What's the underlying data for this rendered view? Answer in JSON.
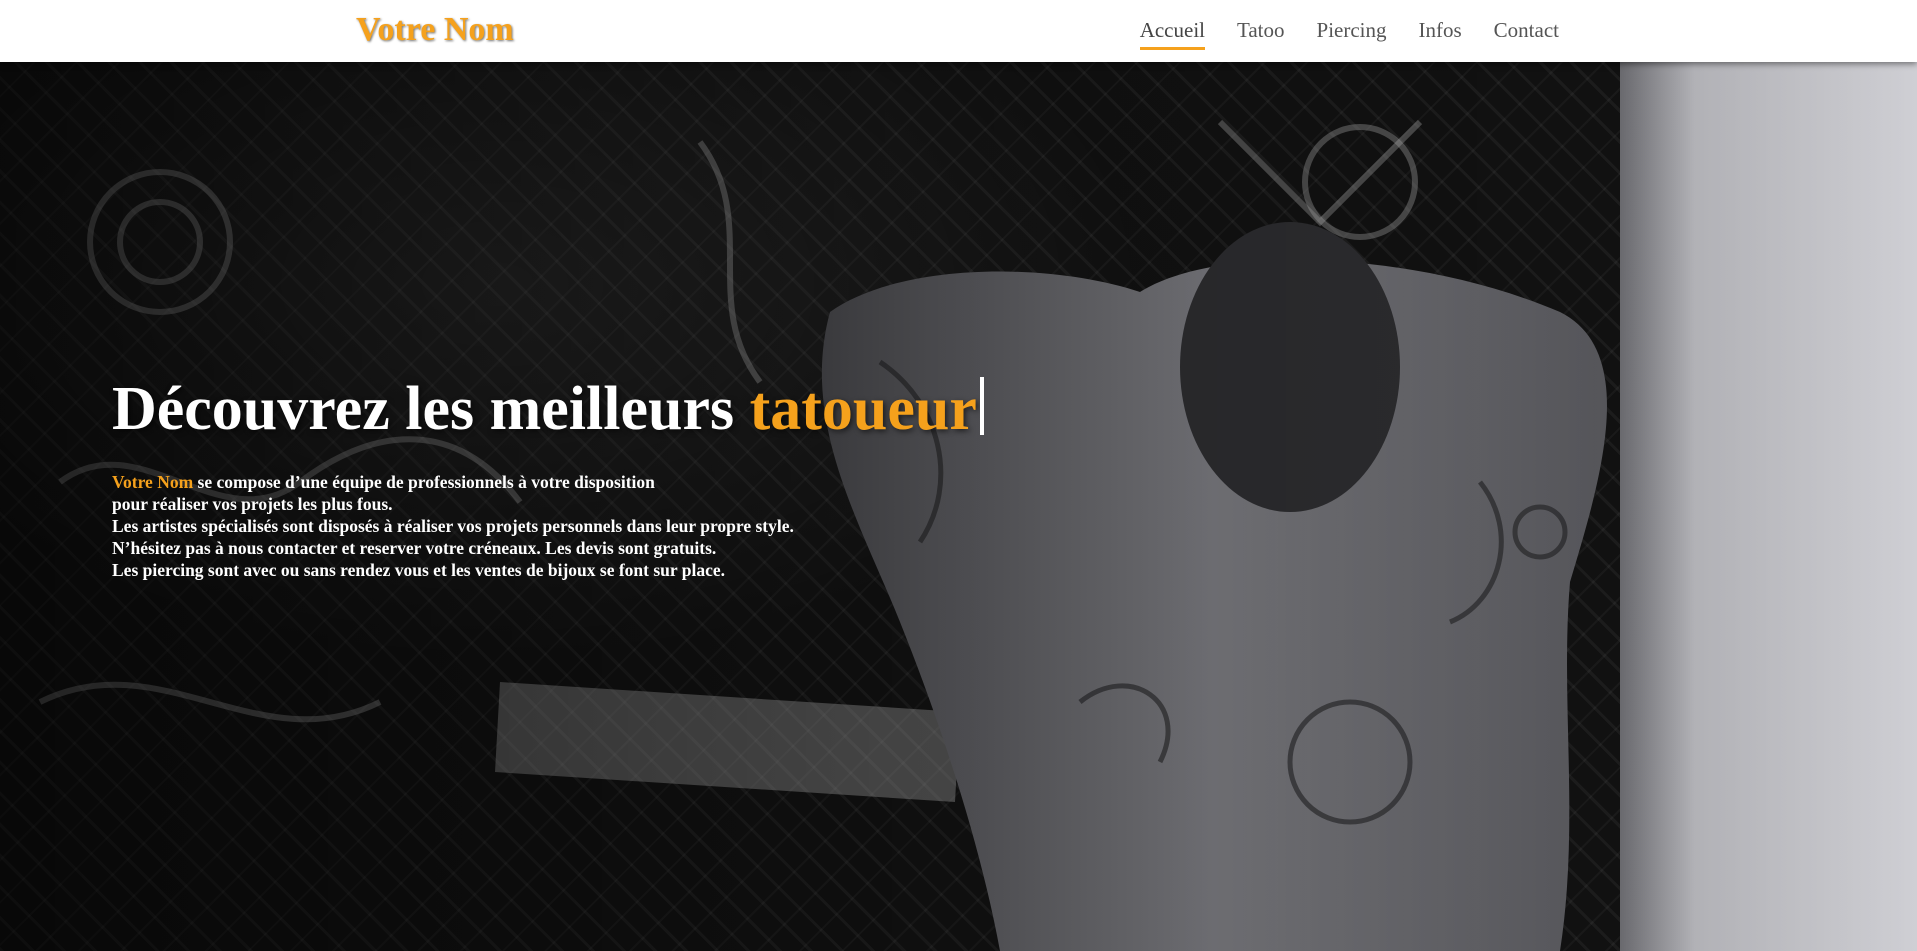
{
  "brand": {
    "name": "Votre Nom",
    "accent_color": "#f5a11c"
  },
  "nav": {
    "items": [
      {
        "label": "Accueil",
        "active": true
      },
      {
        "label": "Tatoo",
        "active": false
      },
      {
        "label": "Piercing",
        "active": false
      },
      {
        "label": "Infos",
        "active": false
      },
      {
        "label": "Contact",
        "active": false
      }
    ]
  },
  "hero": {
    "title_prefix": "Découvrez les meilleurs",
    "title_accent": "tatoueur",
    "intro_brand": "Votre Nom",
    "intro_rest": "se compose d’une équipe de professionnels à votre disposition",
    "lines": [
      "pour réaliser vos projets les plus fous.",
      "Les artistes spécialisés sont disposés à réaliser vos projets personnels dans leur propre style.",
      "N’hésitez pas à nous contacter et reserver votre créneaux. Les devis sont gratuits.",
      "Les piercing sont avec ou sans rendez vous et les ventes de bijoux se font sur place."
    ],
    "background_image": "black-and-white photo of a tattooed person with hands behind head in front of a patterned tapestry"
  }
}
